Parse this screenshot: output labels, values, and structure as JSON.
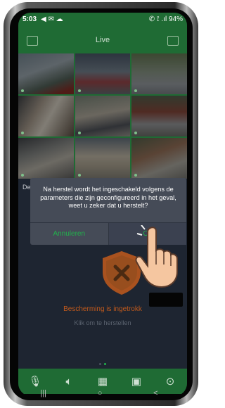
{
  "status": {
    "time": "5:03",
    "icons": "◀ ✉ ☁",
    "right": "✆ ⟟ .ıl 94%"
  },
  "appbar": {
    "title": "Live"
  },
  "mid": {
    "left_label": "De",
    "close": "✕",
    "settings": "⚙"
  },
  "dialog": {
    "message": "Na herstel wordt het ingeschakeld volgens de parameters die zijn geconfigureerd in het geval, weet u zeker dat u herstelt?",
    "cancel": "Annuleren",
    "ok": "Ok"
  },
  "protection": {
    "status": "Bescherming is ingetrokk",
    "hint": "Klik om te herstellen",
    "icon": "shield-x-icon"
  },
  "toolbar": {
    "icons": [
      "microphone-icon",
      "speaker-icon",
      "grid-icon",
      "playback-icon",
      "more-icon"
    ]
  },
  "sysnav": {
    "recent": "|||",
    "home": "○",
    "back": "<"
  },
  "colors": {
    "accent": "#1f6b34",
    "ok": "#22b14c",
    "warning": "#c25a1c"
  }
}
